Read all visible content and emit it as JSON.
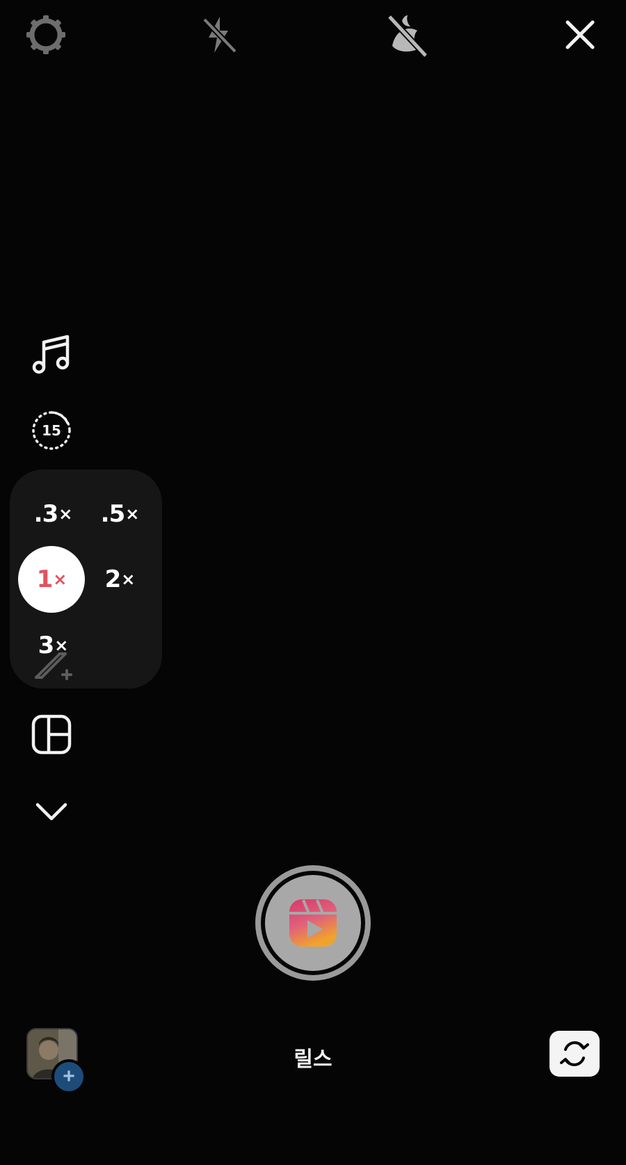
{
  "top_bar": {
    "settings_icon": "settings-gear-icon",
    "flash_icon": "flash-off-icon",
    "night_mode_icon": "night-mode-off-icon",
    "close_icon": "close-icon"
  },
  "left_rail": {
    "music_icon": "music-note-icon",
    "timer_icon": "timer-icon",
    "timer_label": "15",
    "zoom_options": [
      {
        "value": ".3",
        "suffix": "×",
        "active": false
      },
      {
        "value": ".5",
        "suffix": "×",
        "active": false
      },
      {
        "value": "1",
        "suffix": "×",
        "active": true
      },
      {
        "value": "2",
        "suffix": "×",
        "active": false
      },
      {
        "value": "3",
        "suffix": "×",
        "active": false
      }
    ],
    "effects_icon": "magic-wand-icon",
    "layout_icon": "layout-grid-icon",
    "more_icon": "chevron-down-icon"
  },
  "capture": {
    "shutter_icon": "reels-icon",
    "mode_label": "릴스"
  },
  "bottom_bar": {
    "gallery_icon": "gallery-thumbnail",
    "add_icon": "plus-icon",
    "add_symbol": "+",
    "flip_camera_icon": "camera-flip-icon"
  },
  "colors": {
    "background": "#050505",
    "zoom_panel": "#161616",
    "active_zoom_text": "#e0545e",
    "reels_gradient_start": "#d6386a",
    "reels_gradient_end": "#f0a32c"
  }
}
